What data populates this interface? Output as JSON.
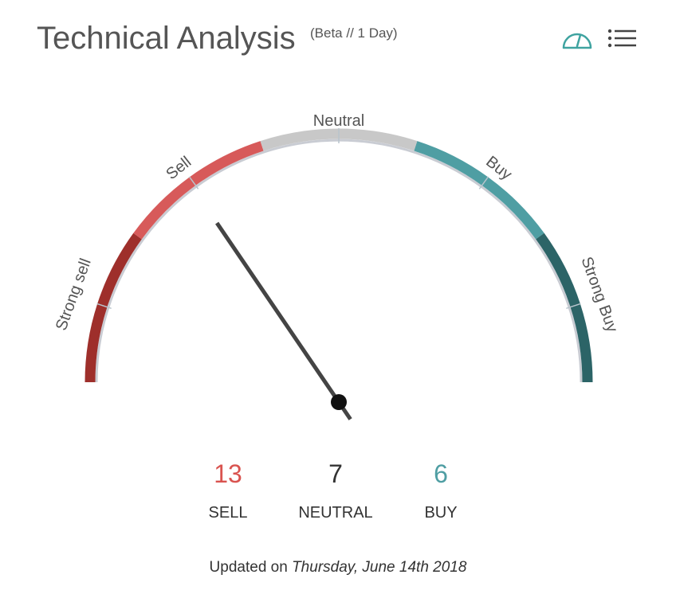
{
  "header": {
    "title": "Technical Analysis",
    "subtitle": "(Beta // 1 Day)",
    "gauge_icon": "speedometer-icon",
    "menu_icon": "list-icon"
  },
  "gauge": {
    "labels": {
      "strong_sell": "Strong sell",
      "sell": "Sell",
      "neutral": "Neutral",
      "buy": "Buy",
      "strong_buy": "Strong Buy"
    },
    "needle_value": -0.38,
    "colors": {
      "strong_sell": "#9e2f2b",
      "sell": "#d75a5a",
      "neutral": "#c8c8c8",
      "buy": "#4f9ea3",
      "strong_buy": "#2c6467",
      "accent": "#3fa3a0"
    }
  },
  "summary": {
    "sell": {
      "count": "13",
      "label": "SELL",
      "color": "#d9534f"
    },
    "neutral": {
      "count": "7",
      "label": "NEUTRAL",
      "color": "#333333"
    },
    "buy": {
      "count": "6",
      "label": "BUY",
      "color": "#4f9ea3"
    }
  },
  "footer": {
    "prefix": "Updated on",
    "date": "Thursday, June 14th 2018"
  }
}
